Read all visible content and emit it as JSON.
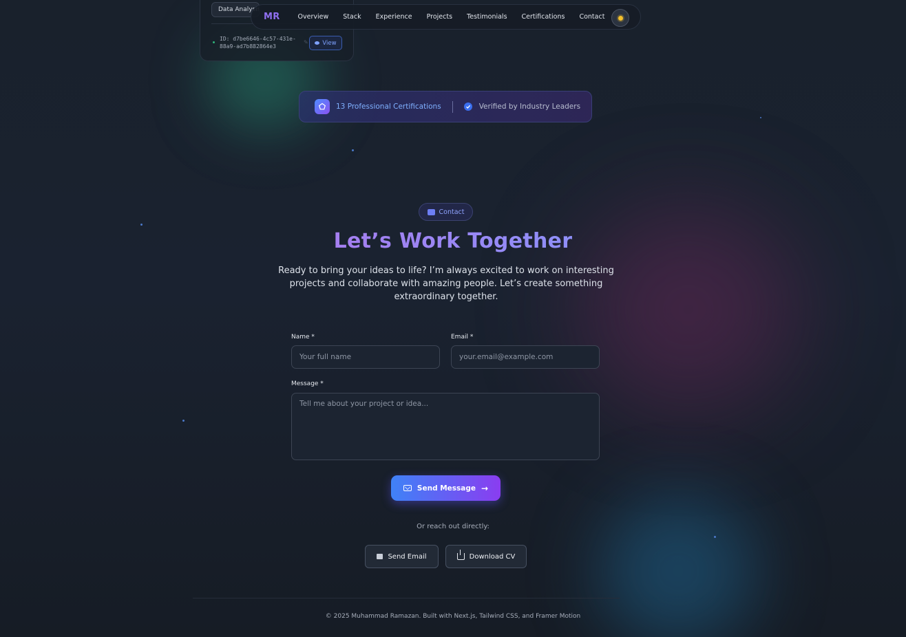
{
  "cert_card": {
    "tag": "Data Analysis",
    "id_text": "ID: d7be6646-4c57-431e-88a9-ad7b882864e3",
    "view_label": "View"
  },
  "nav": {
    "logo": "MR",
    "links": [
      "Overview",
      "Stack",
      "Experience",
      "Projects",
      "Testimonials",
      "Certifications",
      "Contact"
    ],
    "theme_icon": "sun-icon"
  },
  "banner": {
    "count_text": "13 Professional Certifications",
    "verified_text": "Verified by Industry Leaders"
  },
  "contact": {
    "pill_label": "Contact",
    "title": "Let’s Work Together",
    "subtitle": "Ready to bring your ideas to life? I’m always excited to work on interesting projects and collaborate with amazing people. Let’s create something extraordinary together.",
    "form": {
      "name_label": "Name *",
      "name_placeholder": "Your full name",
      "name_value": "",
      "email_label": "Email *",
      "email_placeholder": "your.email@example.com",
      "email_value": "",
      "message_label": "Message *",
      "message_placeholder": "Tell me about your project or idea...",
      "message_value": "",
      "submit_label": "Send Message"
    },
    "reach_text": "Or reach out directly:",
    "send_email_label": "Send Email",
    "download_cv_label": "Download CV"
  },
  "footer": {
    "text": "© 2025 Muhammad Ramazan. Built with Next.js, Tailwind CSS, and Framer Motion"
  },
  "colors": {
    "accent_purple": "#8f6ff0",
    "accent_blue": "#3f82f7",
    "background": "#19212c"
  }
}
